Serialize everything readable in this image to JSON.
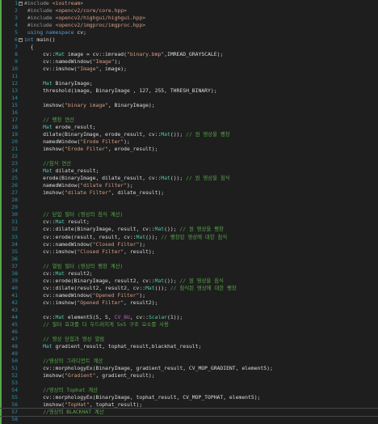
{
  "editor": {
    "lines": [
      {
        "n": "1",
        "fold": "−",
        "segs": [
          [
            "t-pp",
            "#include "
          ],
          [
            "t-str",
            "<iostream>"
          ]
        ]
      },
      {
        "n": "2",
        "segs": [
          [
            "t-pp",
            " #include "
          ],
          [
            "t-str",
            "<opencv2/core/core.hpp>"
          ]
        ]
      },
      {
        "n": "3",
        "segs": [
          [
            "t-pp",
            " #include "
          ],
          [
            "t-str",
            "<opencv2/highgui/highgui.hpp>"
          ]
        ]
      },
      {
        "n": "4",
        "segs": [
          [
            "t-pp",
            " #include "
          ],
          [
            "t-str",
            "<opencv2/imgproc/imgproc.hpp>"
          ]
        ]
      },
      {
        "n": "5",
        "segs": [
          [
            "t-kw",
            " using namespace "
          ],
          [
            "t-plain",
            "cv;"
          ]
        ]
      },
      {
        "n": "6",
        "fold": "−",
        "segs": [
          [
            "t-kw",
            "int "
          ],
          [
            "t-plain",
            "main()"
          ]
        ]
      },
      {
        "n": "7",
        "segs": [
          [
            "t-plain",
            "  {"
          ]
        ]
      },
      {
        "n": "8",
        "segs": [
          [
            "t-plain",
            "      cv::"
          ],
          [
            "t-type",
            "Mat"
          ],
          [
            "t-plain",
            " image = cv::imread("
          ],
          [
            "t-str",
            "\"binary.bmp\""
          ],
          [
            "t-plain",
            ",IMREAD_GRAYSCALE);"
          ]
        ]
      },
      {
        "n": "9",
        "segs": [
          [
            "t-plain",
            "      cv::namedWindow("
          ],
          [
            "t-str",
            "\"Image\""
          ],
          [
            "t-plain",
            ");"
          ]
        ]
      },
      {
        "n": "10",
        "segs": [
          [
            "t-plain",
            "      cv::imshow("
          ],
          [
            "t-str",
            "\"Image\""
          ],
          [
            "t-plain",
            ", image);"
          ]
        ]
      },
      {
        "n": "11",
        "segs": []
      },
      {
        "n": "12",
        "segs": [
          [
            "t-type",
            "      Mat"
          ],
          [
            "t-plain",
            " BinaryImage;"
          ]
        ]
      },
      {
        "n": "13",
        "segs": [
          [
            "t-plain",
            "      threshold(image, BinaryImage , 127, 255, THRESH_BINARY);"
          ]
        ]
      },
      {
        "n": "14",
        "segs": []
      },
      {
        "n": "15",
        "segs": [
          [
            "t-plain",
            "      imshow("
          ],
          [
            "t-str",
            "\"binary image\""
          ],
          [
            "t-plain",
            ", BinaryImage);"
          ]
        ]
      },
      {
        "n": "16",
        "segs": []
      },
      {
        "n": "17",
        "segs": [
          [
            "t-cmt",
            "      // 팽창 연산"
          ]
        ]
      },
      {
        "n": "18",
        "segs": [
          [
            "t-type",
            "      Mat"
          ],
          [
            "t-plain",
            " erode_result;"
          ]
        ]
      },
      {
        "n": "19",
        "segs": [
          [
            "t-plain",
            "      dilate(BinaryImage, erode_result, cv::"
          ],
          [
            "t-type",
            "Mat"
          ],
          [
            "t-plain",
            "()); "
          ],
          [
            "t-cmt",
            "// 원 영상을 팽창"
          ]
        ]
      },
      {
        "n": "20",
        "segs": [
          [
            "t-plain",
            "      namedWindow("
          ],
          [
            "t-str",
            "\"Erode Filter\""
          ],
          [
            "t-plain",
            ");"
          ]
        ]
      },
      {
        "n": "21",
        "segs": [
          [
            "t-plain",
            "      imshow("
          ],
          [
            "t-str",
            "\"Erode Filter\""
          ],
          [
            "t-plain",
            ", erode_result);"
          ]
        ]
      },
      {
        "n": "22",
        "segs": []
      },
      {
        "n": "23",
        "segs": [
          [
            "t-cmt",
            "      //침식 연산"
          ]
        ]
      },
      {
        "n": "24",
        "segs": [
          [
            "t-type",
            "      Mat"
          ],
          [
            "t-plain",
            " dilate_result;"
          ]
        ]
      },
      {
        "n": "25",
        "segs": [
          [
            "t-plain",
            "      erode(BinaryImage, dilate_result, cv::"
          ],
          [
            "t-type",
            "Mat"
          ],
          [
            "t-plain",
            "()); "
          ],
          [
            "t-cmt",
            "// 원 영상을 침식"
          ]
        ]
      },
      {
        "n": "26",
        "segs": [
          [
            "t-plain",
            "      namedWindow("
          ],
          [
            "t-str",
            "\"dilate Filter\""
          ],
          [
            "t-plain",
            ");"
          ]
        ]
      },
      {
        "n": "27",
        "segs": [
          [
            "t-plain",
            "      imshow("
          ],
          [
            "t-str",
            "\"dilate Filter\""
          ],
          [
            "t-plain",
            ", dilate_result);"
          ]
        ]
      },
      {
        "n": "28",
        "segs": []
      },
      {
        "n": "29",
        "segs": []
      },
      {
        "n": "30",
        "segs": [
          [
            "t-cmt",
            "      // 닫힘 필터 (영상의 침식 계산)"
          ]
        ]
      },
      {
        "n": "31",
        "segs": [
          [
            "t-plain",
            "      cv::"
          ],
          [
            "t-type",
            "Mat"
          ],
          [
            "t-plain",
            " result;"
          ]
        ]
      },
      {
        "n": "32",
        "segs": [
          [
            "t-plain",
            "      cv::dilate(BinaryImage, result, cv::"
          ],
          [
            "t-type",
            "Mat"
          ],
          [
            "t-plain",
            "()); "
          ],
          [
            "t-cmt",
            "// 원 영상을 팽창"
          ]
        ]
      },
      {
        "n": "33",
        "segs": [
          [
            "t-plain",
            "      cv::erode(result, result, cv::"
          ],
          [
            "t-type",
            "Mat"
          ],
          [
            "t-plain",
            "()); "
          ],
          [
            "t-cmt",
            "// 팽창된 영상에 대한 침식"
          ]
        ]
      },
      {
        "n": "34",
        "segs": [
          [
            "t-plain",
            "      cv::namedWindow("
          ],
          [
            "t-str",
            "\"Closed Filter\""
          ],
          [
            "t-plain",
            ");"
          ]
        ]
      },
      {
        "n": "35",
        "segs": [
          [
            "t-plain",
            "      cv::imshow("
          ],
          [
            "t-str",
            "\"Closed Filter\""
          ],
          [
            "t-plain",
            ", result);"
          ]
        ]
      },
      {
        "n": "36",
        "segs": []
      },
      {
        "n": "37",
        "segs": [
          [
            "t-cmt",
            "      // 열림 필터 (영상의 팽창 계산)"
          ]
        ]
      },
      {
        "n": "38",
        "segs": [
          [
            "t-plain",
            "      cv::"
          ],
          [
            "t-type",
            "Mat"
          ],
          [
            "t-plain",
            " result2;"
          ]
        ]
      },
      {
        "n": "39",
        "segs": [
          [
            "t-plain",
            "      cv::erode(BinaryImage, result2, cv::"
          ],
          [
            "t-type",
            "Mat"
          ],
          [
            "t-plain",
            "()); "
          ],
          [
            "t-cmt",
            "// 원 영상을 침식"
          ]
        ]
      },
      {
        "n": "40",
        "segs": [
          [
            "t-plain",
            "      cv::dilate(result2, result2, cv::"
          ],
          [
            "t-type",
            "Mat"
          ],
          [
            "t-plain",
            "()); "
          ],
          [
            "t-cmt",
            "// 침식된 영상에 대한 팽창"
          ]
        ]
      },
      {
        "n": "41",
        "segs": [
          [
            "t-plain",
            "      cv::namedWindow("
          ],
          [
            "t-str",
            "\"Opened Filter\""
          ],
          [
            "t-plain",
            ");"
          ]
        ]
      },
      {
        "n": "42",
        "segs": [
          [
            "t-plain",
            "      cv::imshow("
          ],
          [
            "t-str",
            "\"Opened Filter\""
          ],
          [
            "t-plain",
            ", result2);"
          ]
        ]
      },
      {
        "n": "43",
        "segs": []
      },
      {
        "n": "44",
        "segs": [
          [
            "t-plain",
            "      cv::"
          ],
          [
            "t-type",
            "Mat"
          ],
          [
            "t-plain",
            " element5(5, 5, "
          ],
          [
            "t-macro",
            "CV_8U"
          ],
          [
            "t-plain",
            ", cv::"
          ],
          [
            "t-type",
            "Scalar"
          ],
          [
            "t-plain",
            "(1));"
          ]
        ]
      },
      {
        "n": "45",
        "segs": [
          [
            "t-cmt",
            "      // 필터 효과를 더 두드러지게 5x5 구조 요소를 사용"
          ]
        ]
      },
      {
        "n": "46",
        "segs": []
      },
      {
        "n": "47",
        "segs": [
          [
            "t-cmt",
            "      // 영상 닫힘과 영상 열림"
          ]
        ]
      },
      {
        "n": "48",
        "segs": [
          [
            "t-type",
            "      Mat"
          ],
          [
            "t-plain",
            " gradient_result, tophat_result,blackhat_result;"
          ]
        ]
      },
      {
        "n": "49",
        "segs": []
      },
      {
        "n": "50",
        "segs": [
          [
            "t-cmt",
            "      //영상의 그라디언트 계산"
          ]
        ]
      },
      {
        "n": "51",
        "segs": [
          [
            "t-plain",
            "      cv::morphologyEx(BinaryImage, gradient_result, CV_MOP_GRADIENT, element5);"
          ]
        ]
      },
      {
        "n": "52",
        "segs": [
          [
            "t-plain",
            "      imshow("
          ],
          [
            "t-str",
            "\"Gradient\""
          ],
          [
            "t-plain",
            ", gradient_result);"
          ]
        ]
      },
      {
        "n": "53",
        "segs": []
      },
      {
        "n": "54",
        "segs": [
          [
            "t-cmt",
            "      //영상의 Tophat 계산"
          ]
        ]
      },
      {
        "n": "55",
        "segs": [
          [
            "t-plain",
            "      cv::morphologyEx(BinaryImage, tophat_result, CV_MOP_TOPHAT, element5);"
          ]
        ]
      },
      {
        "n": "56",
        "segs": [
          [
            "t-plain",
            "      imshow("
          ],
          [
            "t-str",
            "\"TopHat\""
          ],
          [
            "t-plain",
            ", tophat_result);"
          ]
        ]
      },
      {
        "n": "57",
        "segs": [
          [
            "t-cmt",
            "      //영상의 BLACKHAT 계산"
          ]
        ]
      },
      {
        "n": "58",
        "segs": []
      }
    ],
    "current_line": "57"
  },
  "colors": {
    "background": "#1e1e1e",
    "line_number": "#2b91af",
    "keyword": "#569cd6",
    "type": "#4ec9b0",
    "string": "#d69d85",
    "comment": "#57a64a",
    "macro": "#bd63c5",
    "preprocessor": "#9b9b9b",
    "plain": "#dcdcdc"
  }
}
